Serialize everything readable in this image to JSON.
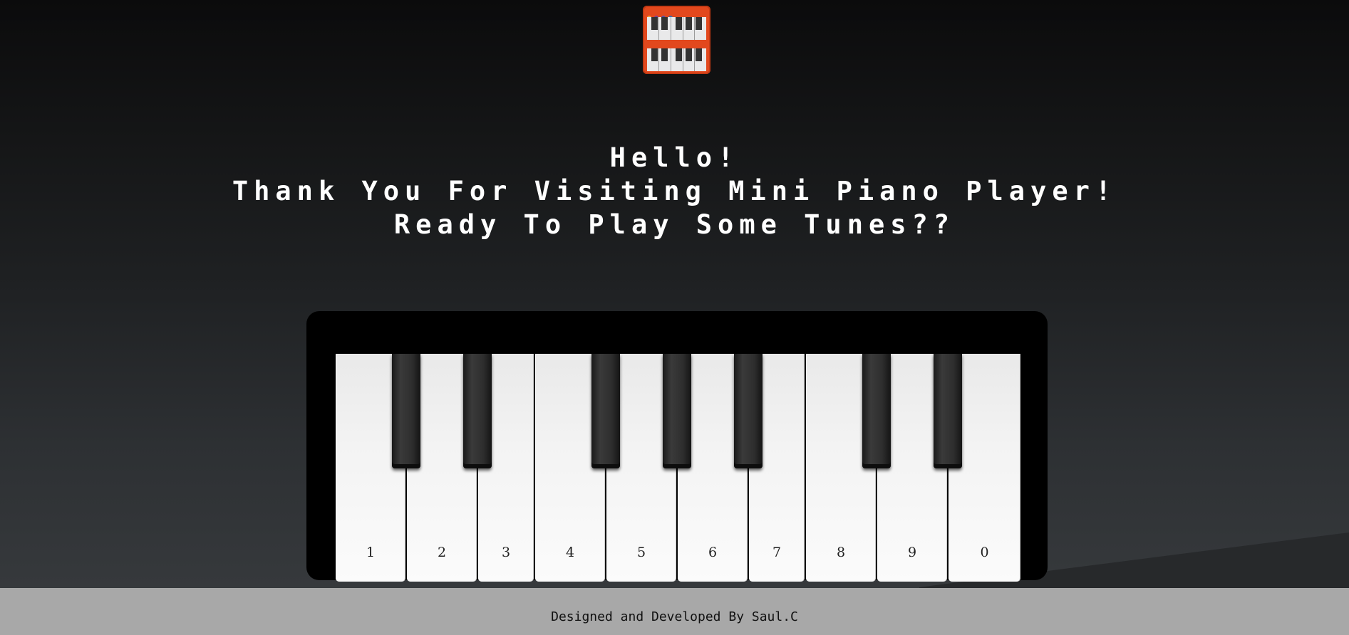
{
  "greeting": {
    "line1": "Hello!",
    "line2": "Thank You For Visiting Mini Piano Player!",
    "line3": "Ready To Play Some Tunes??"
  },
  "logo": {
    "icon": "piano-keyboard-icon",
    "color": "#e2481d"
  },
  "piano": {
    "white_keys": [
      {
        "label": "1"
      },
      {
        "label": "2"
      },
      {
        "label": "3"
      },
      {
        "label": "4"
      },
      {
        "label": "5"
      },
      {
        "label": "6"
      },
      {
        "label": "7"
      },
      {
        "label": "8"
      },
      {
        "label": "9"
      },
      {
        "label": "0"
      }
    ],
    "black_key_count": 7
  },
  "footer": {
    "credit": "Designed and Developed By Saul.C"
  }
}
